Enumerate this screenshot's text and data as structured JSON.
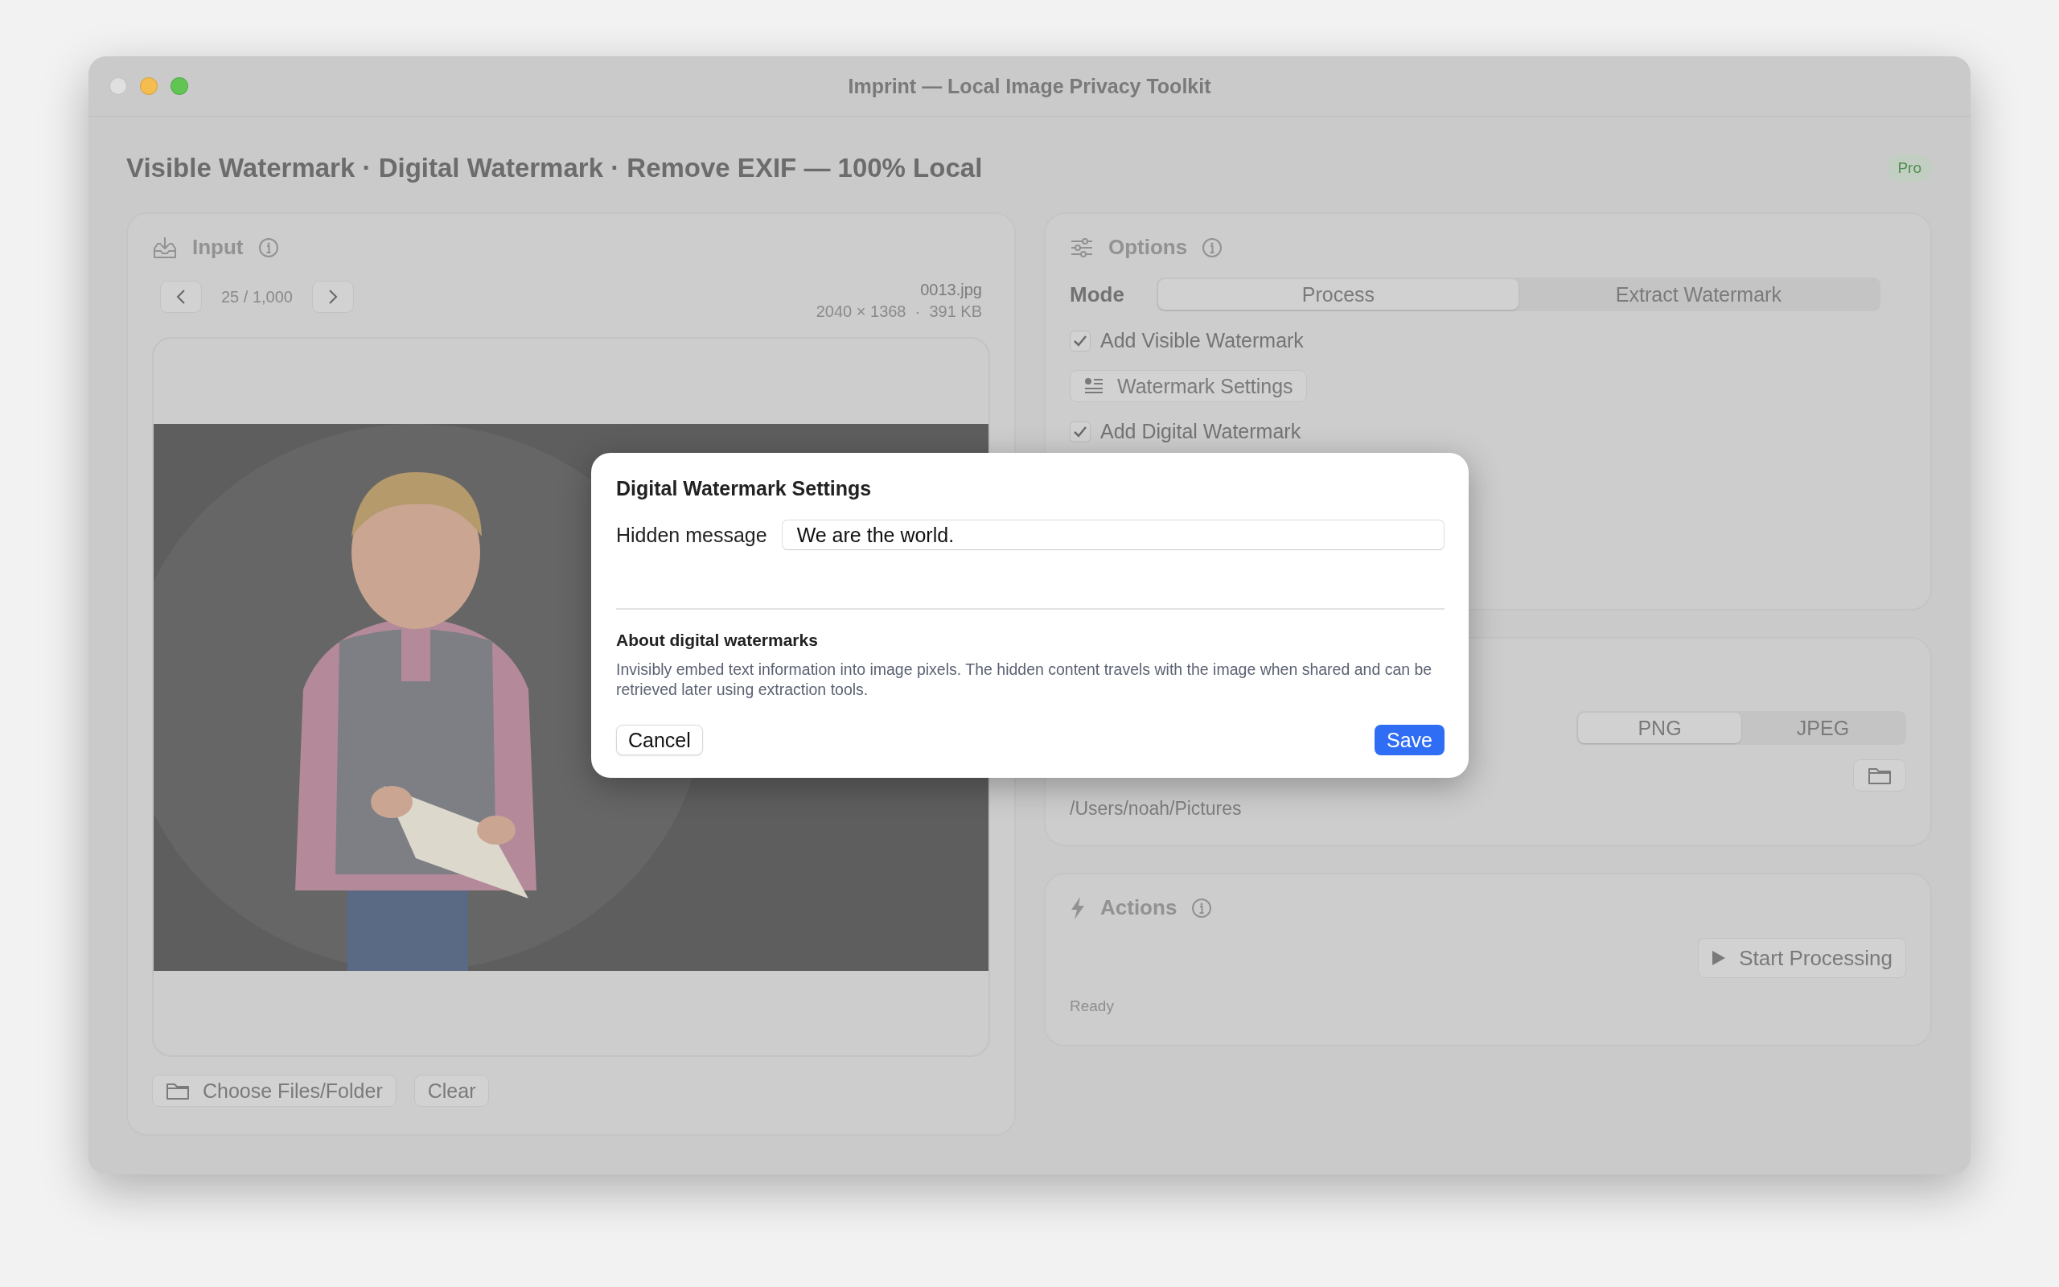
{
  "window": {
    "title": "Imprint — Local Image Privacy Toolkit"
  },
  "header": {
    "headline": "Visible Watermark · Digital Watermark · Remove EXIF — 100% Local",
    "badge": "Pro"
  },
  "input_panel": {
    "title": "Input",
    "counter": "25 / 1,000",
    "file_name": "0013.jpg",
    "file_info": "2040 × 1368  ·  391 KB",
    "buttons": [
      {
        "kind": "folder",
        "label": "Choose Files/Folder"
      },
      {
        "kind": "plain",
        "label": "Clear"
      }
    ]
  },
  "options_panel": {
    "title": "Options",
    "mode_label": "Mode",
    "modes": [
      {
        "label": "Process",
        "selected": true
      },
      {
        "label": "Extract Watermark",
        "selected": false
      }
    ],
    "items": [
      {
        "kind": "checkbox",
        "label": "Add Visible Watermark",
        "checked": true
      },
      {
        "kind": "button",
        "label": "Watermark Settings"
      },
      {
        "kind": "checkbox",
        "label": "Add Digital Watermark",
        "checked": true
      }
    ]
  },
  "output_panel": {
    "formats": [
      {
        "label": "PNG",
        "selected": true
      },
      {
        "label": "JPEG",
        "selected": false
      }
    ],
    "folder_path": "/Users/noah/Pictures"
  },
  "actions_panel": {
    "title": "Actions",
    "start_button": "Start Processing",
    "status": "Ready"
  },
  "dialog": {
    "title": "Digital Watermark Settings",
    "field_label": "Hidden message",
    "field_value": "We are the world.",
    "section_title": "About digital watermarks",
    "description": "Invisibly embed text information into image pixels. The hidden content travels with the image when shared and can be retrieved later using extraction tools.",
    "cancel": "Cancel",
    "save": "Save"
  }
}
